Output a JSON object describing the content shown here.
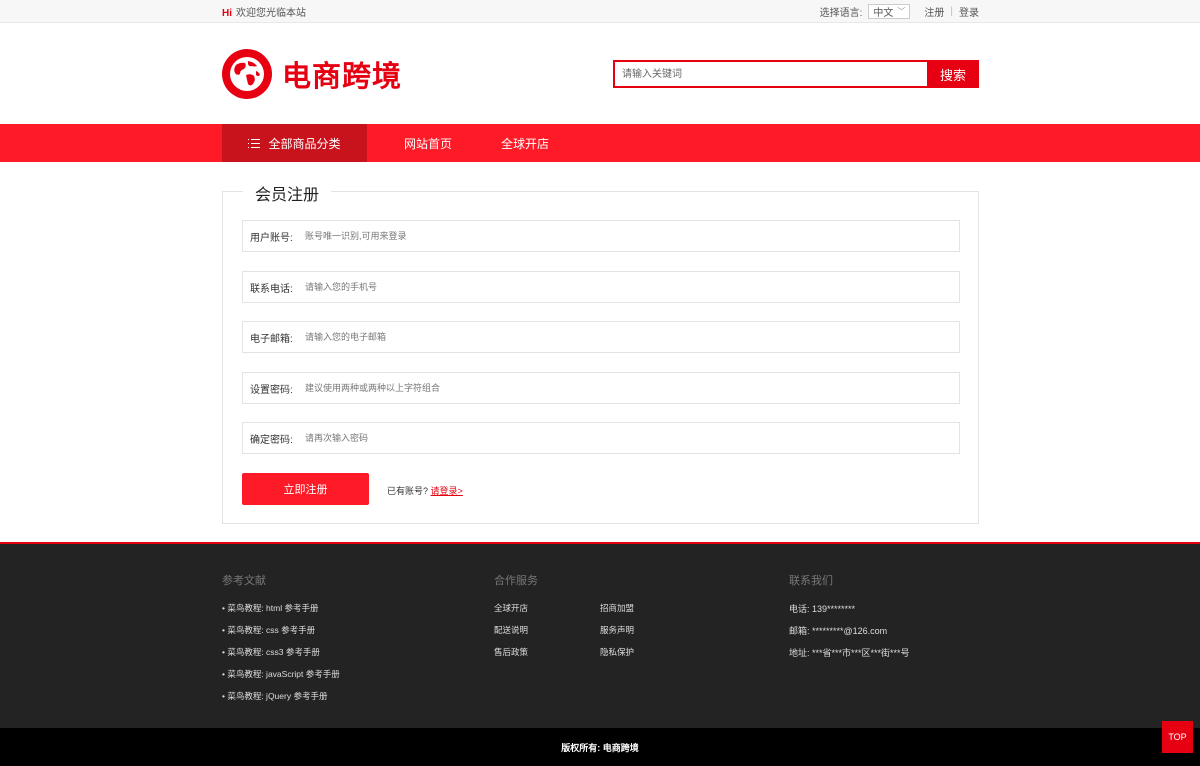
{
  "topbar": {
    "hi": "Hi",
    "welcome": "欢迎您光临本站",
    "lang_label": "选择语言:",
    "lang_value": "中文",
    "register": "注册",
    "separator": "|",
    "login": "登录"
  },
  "header": {
    "logo_text": "电商跨境",
    "search_placeholder": "请输入关键词",
    "search_button": "搜索"
  },
  "nav": {
    "all_categories": "全部商品分类",
    "links": [
      "网站首页",
      "全球开店"
    ]
  },
  "form": {
    "title": "会员注册",
    "fields": [
      {
        "label": "用户账号:",
        "placeholder": "账号唯一识别,可用来登录"
      },
      {
        "label": "联系电话:",
        "placeholder": "请输入您的手机号"
      },
      {
        "label": "电子邮箱:",
        "placeholder": "请输入您的电子邮箱"
      },
      {
        "label": "设置密码:",
        "placeholder": "建议使用两种或两种以上字符组合"
      },
      {
        "label": "确定密码:",
        "placeholder": "请再次输入密码"
      }
    ],
    "submit": "立即注册",
    "has_account": "已有账号?",
    "login_link": "请登录>"
  },
  "footer": {
    "references": {
      "title": "参考文献",
      "items": [
        "• 菜鸟教程: html 参考手册",
        "• 菜鸟教程: css 参考手册",
        "• 菜鸟教程: css3 参考手册",
        "• 菜鸟教程: javaScript 参考手册",
        "• 菜鸟教程: jQuery 参考手册"
      ]
    },
    "services": {
      "title": "合作服务",
      "items": [
        "全球开店",
        "招商加盟",
        "配送说明",
        "服务声明",
        "售后政策",
        "隐私保护"
      ]
    },
    "contact": {
      "title": "联系我们",
      "items": [
        "电话: 139********",
        "邮箱: *********@126.com",
        "地址: ***省***市***区***街***号"
      ]
    },
    "copyright": "版权所有: 电商跨境",
    "top": "TOP"
  },
  "colors": {
    "brand": "#e60012",
    "nav": "#ff1a27",
    "nav_active": "#c8121c",
    "footer": "#232323"
  }
}
